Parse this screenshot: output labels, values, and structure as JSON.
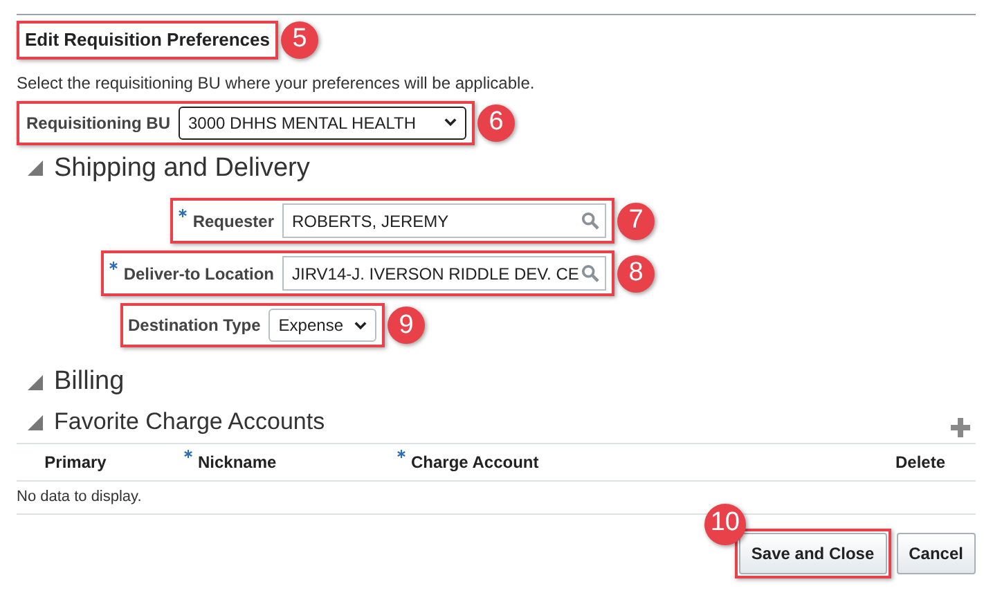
{
  "title": {
    "text": "Edit Requisition Preferences",
    "callout": "5"
  },
  "instruction": "Select the requisitioning BU where your preferences will be applicable.",
  "requisitioning_bu": {
    "label": "Requisitioning BU",
    "value": "3000 DHHS MENTAL HEALTH",
    "callout": "6"
  },
  "sections": [
    {
      "title": "Shipping and Delivery",
      "expanded": true
    }
  ],
  "fields": [
    {
      "kind": "search",
      "label": "Requester",
      "required": true,
      "value": "ROBERTS, JEREMY",
      "callout": "7"
    },
    {
      "kind": "search",
      "label": "Deliver-to Location",
      "required": true,
      "value": "JIRV14-J. IVERSON RIDDLE DEV. CE",
      "callout": "8"
    },
    {
      "kind": "select",
      "label": "Destination Type",
      "required": false,
      "value": "Expense",
      "callout": "9"
    }
  ],
  "billing": {
    "title": "Billing",
    "expanded": true
  },
  "charge_accounts": {
    "title": "Favorite Charge Accounts",
    "expanded": true,
    "columns": [
      {
        "label": "Primary",
        "required": false
      },
      {
        "label": "Nickname",
        "required": true
      },
      {
        "label": "Charge Account",
        "required": true
      },
      {
        "label": "Delete",
        "required": false
      }
    ],
    "empty_text": "No data to display."
  },
  "buttons": [
    {
      "label": "Save and Close",
      "callout": "10"
    },
    {
      "label": "Cancel"
    }
  ]
}
